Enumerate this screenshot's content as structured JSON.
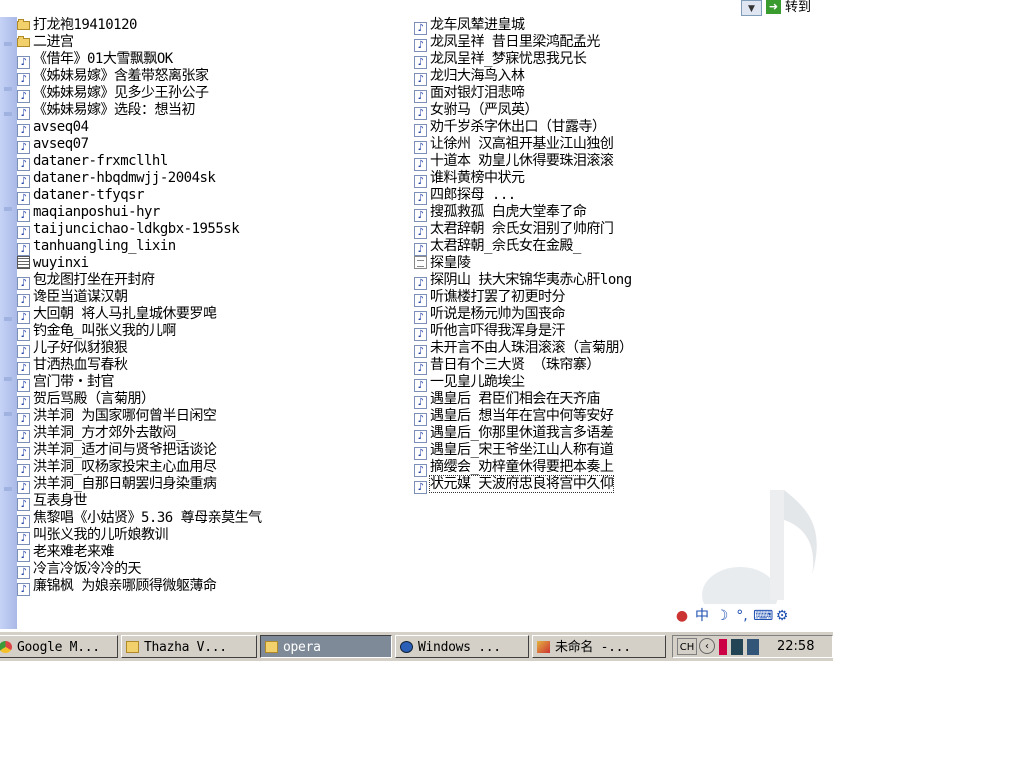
{
  "address_bar": {
    "go_label": "转到"
  },
  "files_left": [
    {
      "name": "打龙袍19410120",
      "icon": "folder-icon"
    },
    {
      "name": "二进宫",
      "icon": "folder-icon"
    },
    {
      "name": "《借年》01大雪飘飘OK",
      "icon": "audio-file-icon"
    },
    {
      "name": "《姊妹易嫁》含羞带怒离张家",
      "icon": "audio-file-icon"
    },
    {
      "name": "《姊妹易嫁》见多少王孙公子",
      "icon": "audio-file-icon"
    },
    {
      "name": "《姊妹易嫁》选段：想当初",
      "icon": "audio-file-icon"
    },
    {
      "name": "avseq04",
      "icon": "audio-file-icon"
    },
    {
      "name": "avseq07",
      "icon": "audio-file-icon"
    },
    {
      "name": "dataner-frxmcllhl",
      "icon": "audio-file-icon"
    },
    {
      "name": "dataner-hbqdmwjj-2004sk",
      "icon": "audio-file-icon"
    },
    {
      "name": "dataner-tfyqsr",
      "icon": "audio-file-icon"
    },
    {
      "name": "maqianposhui-hyr",
      "icon": "audio-file-icon"
    },
    {
      "name": "taijuncichao-ldkgbx-1955sk",
      "icon": "audio-file-icon"
    },
    {
      "name": "tanhuangling_lixin",
      "icon": "audio-file-icon"
    },
    {
      "name": "wuyinxi",
      "icon": "grid-file-icon"
    },
    {
      "name": "包龙图打坐在开封府",
      "icon": "audio-file-icon"
    },
    {
      "name": "谗臣当道谋汉朝",
      "icon": "audio-file-icon"
    },
    {
      "name": "大回朝 将人马扎皇城休要罗唣",
      "icon": "audio-file-icon"
    },
    {
      "name": "钓金龟_叫张义我的儿啊",
      "icon": "audio-file-icon"
    },
    {
      "name": "儿子好似豺狼狠",
      "icon": "audio-file-icon"
    },
    {
      "name": "甘洒热血写春秋",
      "icon": "audio-file-icon"
    },
    {
      "name": "宫门带・封官",
      "icon": "audio-file-icon"
    },
    {
      "name": "贺后骂殿（言菊朋）",
      "icon": "audio-file-icon"
    },
    {
      "name": "洪羊洞 为国家哪何曾半日闲空",
      "icon": "audio-file-icon"
    },
    {
      "name": "洪羊洞_方才郊外去散闷_",
      "icon": "audio-file-icon"
    },
    {
      "name": "洪羊洞_适才间与贤爷把话谈论",
      "icon": "audio-file-icon"
    },
    {
      "name": "洪羊洞_叹杨家投宋主心血用尽",
      "icon": "audio-file-icon"
    },
    {
      "name": "洪羊洞_自那日朝罢归身染重病",
      "icon": "audio-file-icon"
    },
    {
      "name": "互表身世",
      "icon": "audio-file-icon"
    },
    {
      "name": "焦黎唱《小姑贤》5.36 尊母亲莫生气",
      "icon": "audio-file-icon"
    },
    {
      "name": "叫张义我的儿听娘教训",
      "icon": "audio-file-icon"
    },
    {
      "name": "老来难老来难",
      "icon": "audio-file-icon"
    },
    {
      "name": "冷言冷饭冷冷的天",
      "icon": "audio-file-icon"
    },
    {
      "name": "廉锦枫 为娘亲哪顾得微躯薄命",
      "icon": "audio-file-icon"
    }
  ],
  "files_right": [
    {
      "name": "龙车凤辇进皇城",
      "icon": "audio-file-icon"
    },
    {
      "name": "龙凤呈祥 昔日里梁鸿配孟光",
      "icon": "audio-file-icon"
    },
    {
      "name": "龙凤呈祥_梦寐忧思我兄长",
      "icon": "audio-file-icon"
    },
    {
      "name": "龙归大海鸟入林",
      "icon": "audio-file-icon"
    },
    {
      "name": "面对银灯泪悲啼",
      "icon": "audio-file-icon"
    },
    {
      "name": "女驸马（严凤英）",
      "icon": "audio-file-icon"
    },
    {
      "name": "劝千岁杀字休出口（甘露寺）",
      "icon": "audio-file-icon"
    },
    {
      "name": "让徐州 汉高祖开基业江山独创",
      "icon": "audio-file-icon"
    },
    {
      "name": "十道本 劝皇儿休得要珠泪滚滚",
      "icon": "audio-file-icon"
    },
    {
      "name": "谁料黄榜中状元",
      "icon": "audio-file-icon"
    },
    {
      "name": "四郎探母 ...",
      "icon": "audio-file-icon"
    },
    {
      "name": "搜孤救孤 白虎大堂奉了命",
      "icon": "audio-file-icon"
    },
    {
      "name": "太君辞朝 佘氏女泪别了帅府门",
      "icon": "audio-file-icon"
    },
    {
      "name": "太君辞朝_佘氏女在金殿_",
      "icon": "audio-file-icon"
    },
    {
      "name": "探皇陵",
      "icon": "document-icon"
    },
    {
      "name": "探阴山 扶大宋锦华夷赤心肝long",
      "icon": "audio-file-icon"
    },
    {
      "name": "听谯楼打罢了初更时分",
      "icon": "audio-file-icon"
    },
    {
      "name": "听说是杨元帅为国丧命",
      "icon": "audio-file-icon"
    },
    {
      "name": "听他言吓得我浑身是汗",
      "icon": "audio-file-icon"
    },
    {
      "name": "未开言不由人珠泪滚滚（言菊朋）",
      "icon": "audio-file-icon"
    },
    {
      "name": "昔日有个三大贤 （珠帘寨）",
      "icon": "audio-file-icon"
    },
    {
      "name": "一见皇儿跪埃尘",
      "icon": "audio-file-icon"
    },
    {
      "name": "遇皇后 君臣们相会在天齐庙",
      "icon": "audio-file-icon"
    },
    {
      "name": "遇皇后 想当年在宫中何等安好",
      "icon": "audio-file-icon"
    },
    {
      "name": "遇皇后_你那里休道我言多语差",
      "icon": "audio-file-icon"
    },
    {
      "name": "遇皇后_宋王爷坐江山人称有道",
      "icon": "audio-file-icon"
    },
    {
      "name": "摘缨会_劝梓童休得要把本奏上",
      "icon": "audio-file-icon"
    },
    {
      "name": "状元媒 天波府忠良将宫中久仰",
      "icon": "audio-file-icon",
      "selected": true
    }
  ],
  "taskbar": {
    "tasks": [
      {
        "label": "Google M...",
        "icon": "chrome-icon",
        "active": false
      },
      {
        "label": "Thazha V...",
        "icon": "folder-icon",
        "active": false
      },
      {
        "label": "opera",
        "icon": "folder-icon",
        "active": true
      },
      {
        "label": "Windows ...",
        "icon": "media-player-icon",
        "active": false
      },
      {
        "label": "未命名 -...",
        "icon": "paint-icon",
        "active": false
      }
    ],
    "ime_label": "CH",
    "clock": "22:58"
  },
  "ime_bar": {
    "mode": "中",
    "icons": [
      "color-balls-icon",
      "chinese-mode-icon",
      "moon-icon",
      "punctuation-icon",
      "keyboard-icon",
      "settings-icon"
    ]
  }
}
